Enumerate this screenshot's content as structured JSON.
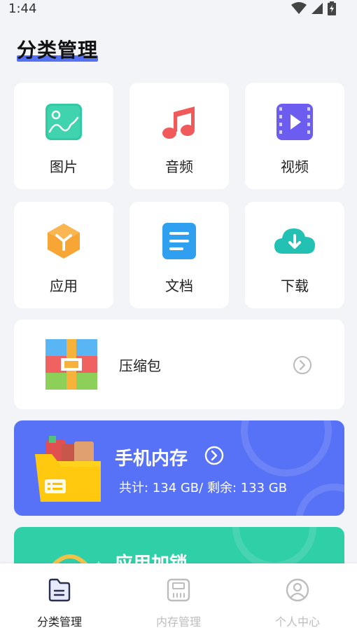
{
  "status_bar": {
    "time": "1:44",
    "icons": [
      "wifi-icon",
      "signal-icon",
      "battery-icon"
    ]
  },
  "page": {
    "title": "分类管理"
  },
  "categories": [
    {
      "label": "图片",
      "icon": "image-icon",
      "color": "#34c9a5"
    },
    {
      "label": "音频",
      "icon": "music-icon",
      "color": "#f05a5a"
    },
    {
      "label": "视频",
      "icon": "video-icon",
      "color": "#6c5cf0"
    },
    {
      "label": "应用",
      "icon": "app-icon",
      "color": "#f7a535"
    },
    {
      "label": "文档",
      "icon": "document-icon",
      "color": "#2fa0f0"
    },
    {
      "label": "下载",
      "icon": "cloud-download-icon",
      "color": "#22c1b4"
    }
  ],
  "archive": {
    "label": "压缩包",
    "icon": "archive-icon"
  },
  "storage": {
    "title": "手机内存",
    "detail": "共计: 134 GB/ 剩余: 133 GB",
    "color": "#5772f6"
  },
  "app_lock": {
    "title": "应用加锁",
    "color": "#2fcfa8"
  },
  "tabbar": {
    "items": [
      {
        "label": "分类管理",
        "icon": "category-icon",
        "active": true
      },
      {
        "label": "内存管理",
        "icon": "storage-icon",
        "active": false
      },
      {
        "label": "个人中心",
        "icon": "profile-icon",
        "active": false
      }
    ],
    "active_color": "#222222",
    "inactive_color": "#bdbdbd"
  }
}
